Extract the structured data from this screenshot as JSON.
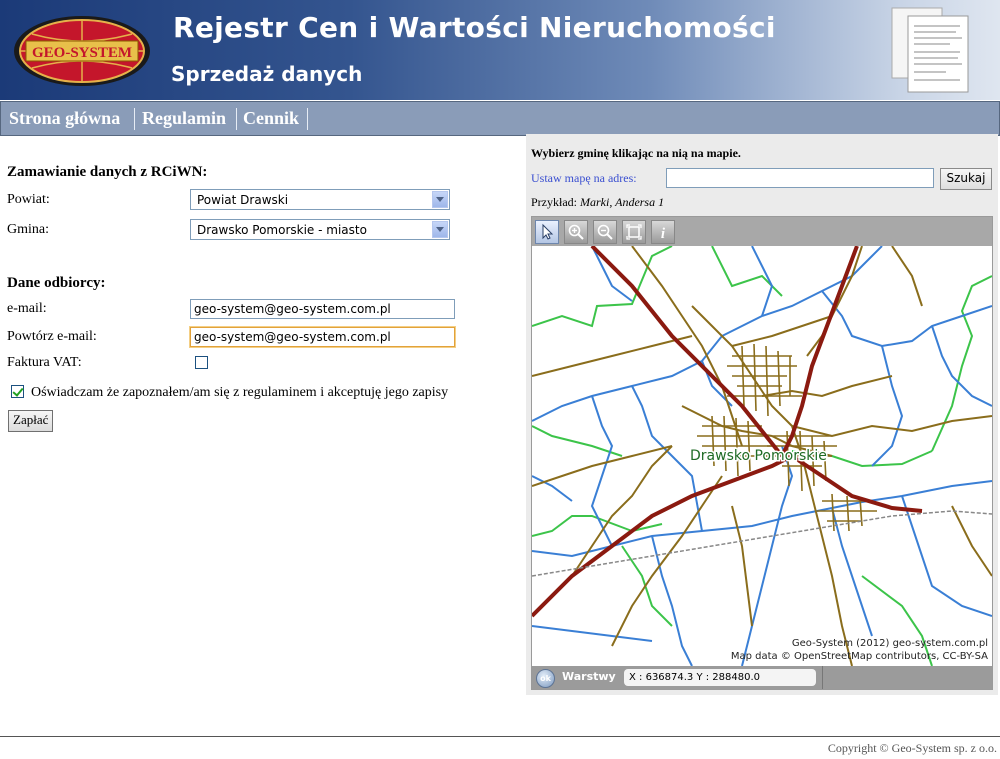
{
  "header": {
    "title": "Rejestr Cen i Wartości Nieruchomości",
    "subtitle": "Sprzedaż danych",
    "logo_text": "GEO-SYSTEM"
  },
  "nav": [
    {
      "label": "Strona główna"
    },
    {
      "label": "Regulamin"
    },
    {
      "label": "Cennik"
    }
  ],
  "form": {
    "order_heading": "Zamawianie danych z RCiWN:",
    "powiat_label": "Powiat:",
    "powiat_value": "Powiat Drawski",
    "gmina_label": "Gmina:",
    "gmina_value": "Drawsko Pomorskie - miasto",
    "recipient_heading": "Dane odbiorcy:",
    "email_label": "e-mail:",
    "email_value": "geo-system@geo-system.com.pl",
    "email_repeat_label": "Powtórz e-mail:",
    "email_repeat_value": "geo-system@geo-system.com.pl",
    "invoice_label": "Faktura VAT:",
    "invoice_checked": false,
    "terms_label": "Oświadczam że zapoznałem/am się z regulaminem i akceptuję jego zapisy",
    "terms_checked": true,
    "pay_button": "Zapłać"
  },
  "map_panel": {
    "instruction": "Wybierz gminę klikając na nią na mapie.",
    "address_link": "Ustaw mapę na adres:",
    "address_value": "",
    "search_button": "Szukaj",
    "example_label": "Przykład:",
    "example_value": "Marki, Andersa 1",
    "tools": [
      "pointer-icon",
      "zoom-in-icon",
      "zoom-out-icon",
      "zoom-extent-icon",
      "info-icon"
    ],
    "place_label": "Drawsko Pomorskie",
    "attribution_1": "Geo-System (2012) geo-system.com.pl",
    "attribution_2": "Map data © OpenStreetMap contributors, CC-BY-SA",
    "ok_label": "ok",
    "layers_label": "Warstwy",
    "coords": "X : 636874.3  Y : 288480.0"
  },
  "footer": {
    "copyright": "Copyright © Geo-System sp. z o.o."
  },
  "colors": {
    "header_dark": "#1b3a78",
    "nav_bg": "#8a9cb8",
    "road_main": "#8b1a10",
    "road_local": "#8a6d1c",
    "boundary_blue": "#3a7fd5",
    "boundary_green": "#3cc44a"
  }
}
